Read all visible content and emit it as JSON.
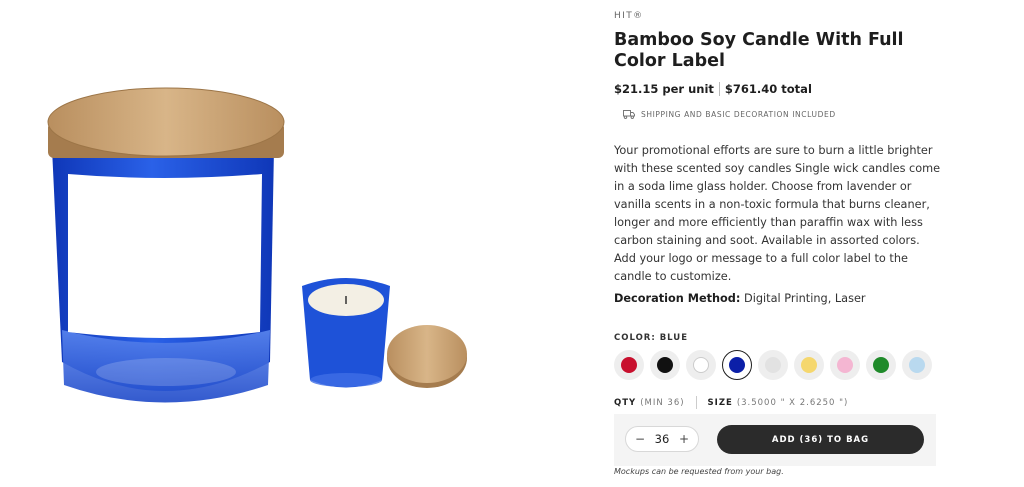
{
  "product": {
    "brand": "HIT®",
    "title": "Bamboo Soy Candle With Full Color Label",
    "price_per_unit": "$21.15 per unit",
    "price_total": "$761.40 total",
    "shipping_note": "SHIPPING AND BASIC DECORATION INCLUDED",
    "description": "Your promotional efforts are sure to burn a little brighter with these scented soy candles Single wick candles come in a soda lime glass holder. Choose from lavender or vanilla scents in a non-toxic formula that burns cleaner, longer and more efficiently than paraffin wax with less carbon staining and soot. Available in assorted colors. Add your logo or message to a full color label to the candle to customize.",
    "decoration_label": "Decoration Method:",
    "decoration_value": "Digital Printing, Laser"
  },
  "color": {
    "label": "COLOR: BLUE",
    "selected_index": 3,
    "swatches": [
      {
        "name": "red",
        "hex": "#c8102e"
      },
      {
        "name": "black",
        "hex": "#111111"
      },
      {
        "name": "white",
        "hex": "#ffffff"
      },
      {
        "name": "blue",
        "hex": "#0b1fa8"
      },
      {
        "name": "gray",
        "hex": "#e2e2e2"
      },
      {
        "name": "yellow",
        "hex": "#f5d76e"
      },
      {
        "name": "pink",
        "hex": "#f4b6d2"
      },
      {
        "name": "green",
        "hex": "#1f8a2a"
      },
      {
        "name": "light-blue",
        "hex": "#b9d9ef"
      }
    ]
  },
  "qty": {
    "label": "QTY",
    "min": "(MIN 36)",
    "value": "36",
    "minus": "−",
    "plus": "+"
  },
  "size": {
    "label": "SIZE",
    "value": "(3.5000 \" X 2.6250 \")"
  },
  "cart": {
    "add_label": "ADD (36) TO BAG",
    "mockup_note": "Mockups can be requested from your bag."
  },
  "colors": {
    "jar_blue": "#1f4fd8",
    "bamboo": "#c9a477",
    "button_dark": "#2b2b2b"
  },
  "icons": {
    "shipping": "truck-icon"
  }
}
